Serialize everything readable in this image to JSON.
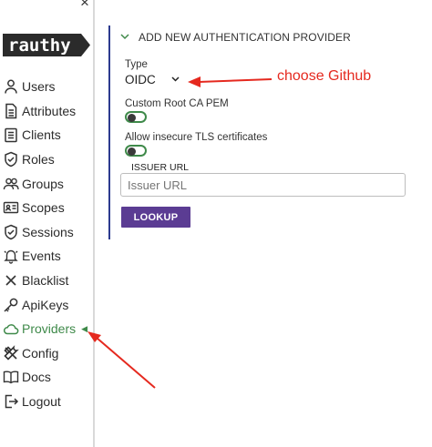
{
  "sidebar": {
    "close_glyph": "×",
    "logo_text": "rauthy",
    "items": [
      {
        "label": "Users",
        "icon": "user-icon"
      },
      {
        "label": "Attributes",
        "icon": "document-icon"
      },
      {
        "label": "Clients",
        "icon": "clipboard-icon"
      },
      {
        "label": "Roles",
        "icon": "shield-check-icon"
      },
      {
        "label": "Groups",
        "icon": "people-icon"
      },
      {
        "label": "Scopes",
        "icon": "id-card-icon"
      },
      {
        "label": "Sessions",
        "icon": "shield-check-icon"
      },
      {
        "label": "Events",
        "icon": "bell-icon"
      },
      {
        "label": "Blacklist",
        "icon": "x-icon"
      },
      {
        "label": "ApiKeys",
        "icon": "key-icon"
      },
      {
        "label": "Providers",
        "icon": "cloud-icon",
        "active": true
      },
      {
        "label": "Config",
        "icon": "tools-icon"
      },
      {
        "label": "Docs",
        "icon": "book-icon"
      },
      {
        "label": "Logout",
        "icon": "logout-icon"
      }
    ]
  },
  "form": {
    "section_title": "ADD NEW AUTHENTICATION PROVIDER",
    "type_label": "Type",
    "type_value": "OIDC",
    "custom_root_ca_label": "Custom Root CA PEM",
    "insecure_tls_label": "Allow insecure TLS certificates",
    "issuer_legend": "ISSUER URL",
    "issuer_placeholder": "Issuer URL",
    "lookup_label": "LOOKUP"
  },
  "annotation": {
    "text": "choose Github",
    "color": "#e5291f"
  },
  "colors": {
    "accent_green": "#3f8a4a",
    "button_purple": "#5b3c93",
    "section_bar": "#2d3b8f",
    "logo_bg": "#2b2b2b"
  }
}
